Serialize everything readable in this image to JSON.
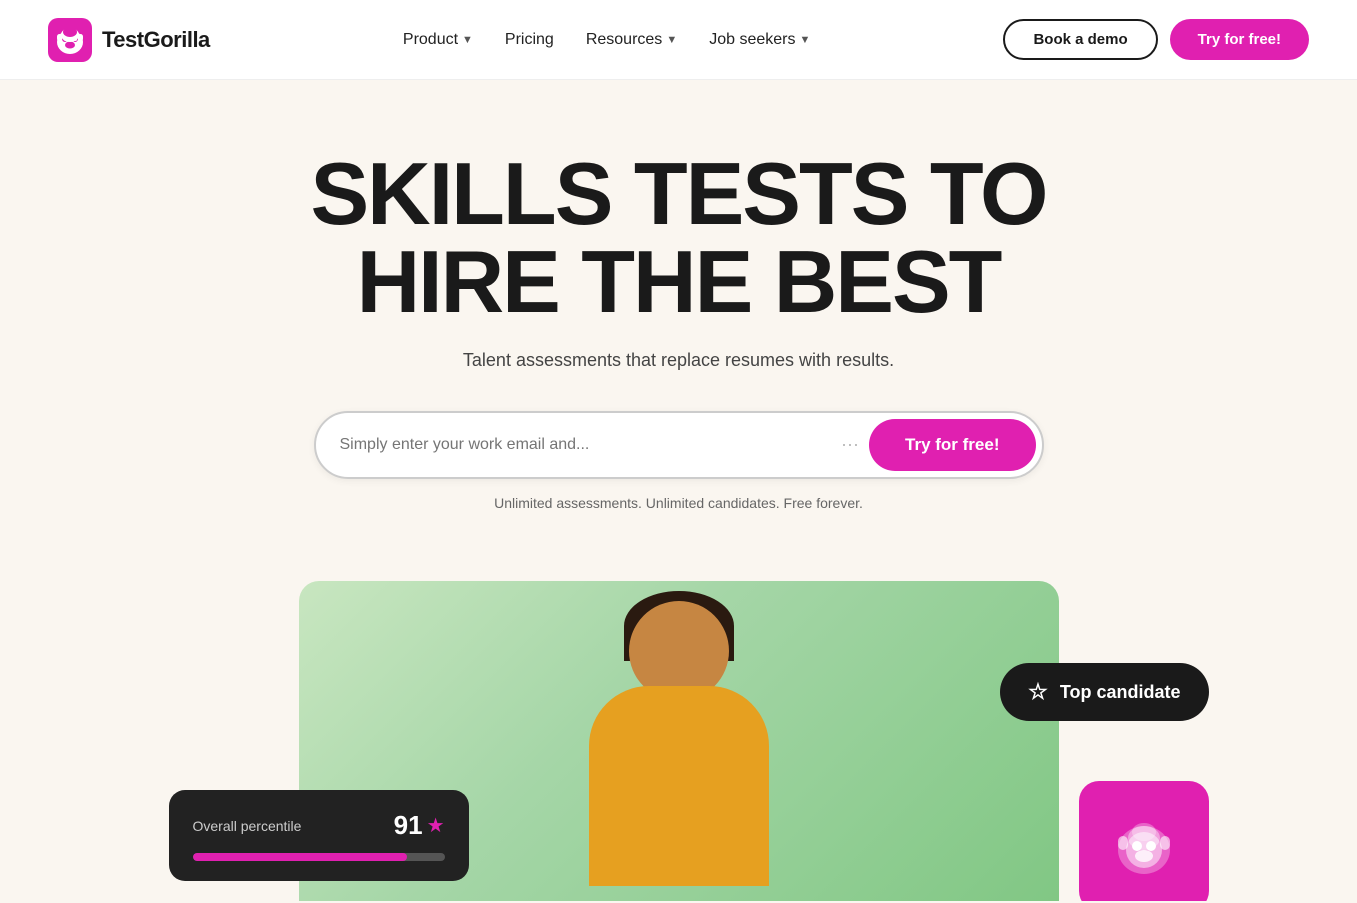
{
  "navbar": {
    "logo_text": "TestGorilla",
    "nav_items": [
      {
        "label": "Product",
        "has_dropdown": true
      },
      {
        "label": "Pricing",
        "has_dropdown": false
      },
      {
        "label": "Resources",
        "has_dropdown": true
      },
      {
        "label": "Job seekers",
        "has_dropdown": true
      }
    ],
    "btn_demo": "Book a demo",
    "btn_free": "Try for free!"
  },
  "hero": {
    "headline_line1": "SKILLS TESTS TO",
    "headline_line2": "HIRE THE BEST",
    "subheadline": "Talent assessments that replace resumes with results.",
    "email_placeholder": "Simply enter your work email and...",
    "btn_try": "Try for free!",
    "tagline": "Unlimited assessments. Unlimited candidates. Free forever."
  },
  "cards": {
    "percentile": {
      "label": "Overall percentile",
      "value": "91",
      "progress_pct": 85
    },
    "top_candidate": {
      "label": "Top candidate"
    }
  }
}
